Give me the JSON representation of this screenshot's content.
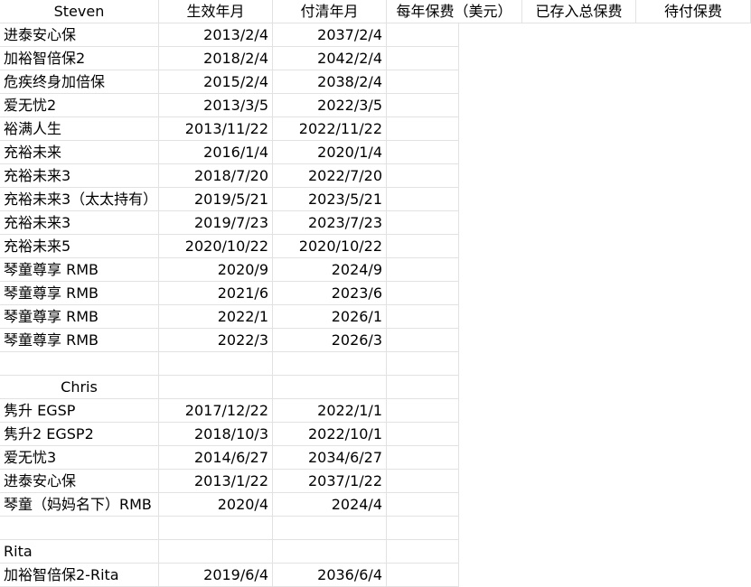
{
  "header": {
    "name": "Steven",
    "start": "生效年月",
    "paid_off": "付清年月",
    "annual_premium": "每年保费（美元）",
    "deposited_total": "已存入总保费",
    "pending": "待付保费"
  },
  "rows": [
    {
      "name": "进泰安心保",
      "start": "2013/2/4",
      "end": "2037/2/4"
    },
    {
      "name": "加裕智倍保2",
      "start": "2018/2/4",
      "end": "2042/2/4"
    },
    {
      "name": "危疾终身加倍保",
      "start": "2015/2/4",
      "end": "2038/2/4"
    },
    {
      "name": "爱无忧2",
      "start": "2013/3/5",
      "end": "2022/3/5"
    },
    {
      "name": "裕满人生",
      "start": "2013/11/22",
      "end": "2022/11/22"
    },
    {
      "name": "充裕未来",
      "start": "2016/1/4",
      "end": "2020/1/4"
    },
    {
      "name": "充裕未来3",
      "start": "2018/7/20",
      "end": "2022/7/20"
    },
    {
      "name": "充裕未来3（太太持有）",
      "start": "2019/5/21",
      "end": "2023/5/21"
    },
    {
      "name": "充裕未来3",
      "start": "2019/7/23",
      "end": "2023/7/23"
    },
    {
      "name": "充裕未来5",
      "start": "2020/10/22",
      "end": "2020/10/22"
    },
    {
      "name": "琴童尊享 RMB",
      "start": "2020/9",
      "end": "2024/9"
    },
    {
      "name": "琴童尊享 RMB",
      "start": "2021/6",
      "end": "2023/6"
    },
    {
      "name": "琴童尊享 RMB",
      "start": "2022/1",
      "end": "2026/1"
    },
    {
      "name": "琴童尊享 RMB",
      "start": "2022/3",
      "end": "2026/3"
    },
    {
      "name": "",
      "start": "",
      "end": ""
    },
    {
      "name": "Chris",
      "start": "",
      "end": "",
      "center": true
    },
    {
      "name": "隽升 EGSP",
      "start": "2017/12/22",
      "end": "2022/1/1"
    },
    {
      "name": "隽升2 EGSP2",
      "start": "2018/10/3",
      "end": "2022/10/1"
    },
    {
      "name": "爱无忧3",
      "start": "2014/6/27",
      "end": "2034/6/27"
    },
    {
      "name": "进泰安心保",
      "start": "2013/1/22",
      "end": "2037/1/22"
    },
    {
      "name": "琴童（妈妈名下）RMB",
      "start": "2020/4",
      "end": "2024/4"
    },
    {
      "name": "",
      "start": "",
      "end": ""
    },
    {
      "name": "Rita",
      "start": "",
      "end": ""
    },
    {
      "name": "加裕智倍保2-Rita",
      "start": "2019/6/4",
      "end": "2036/6/4"
    }
  ]
}
